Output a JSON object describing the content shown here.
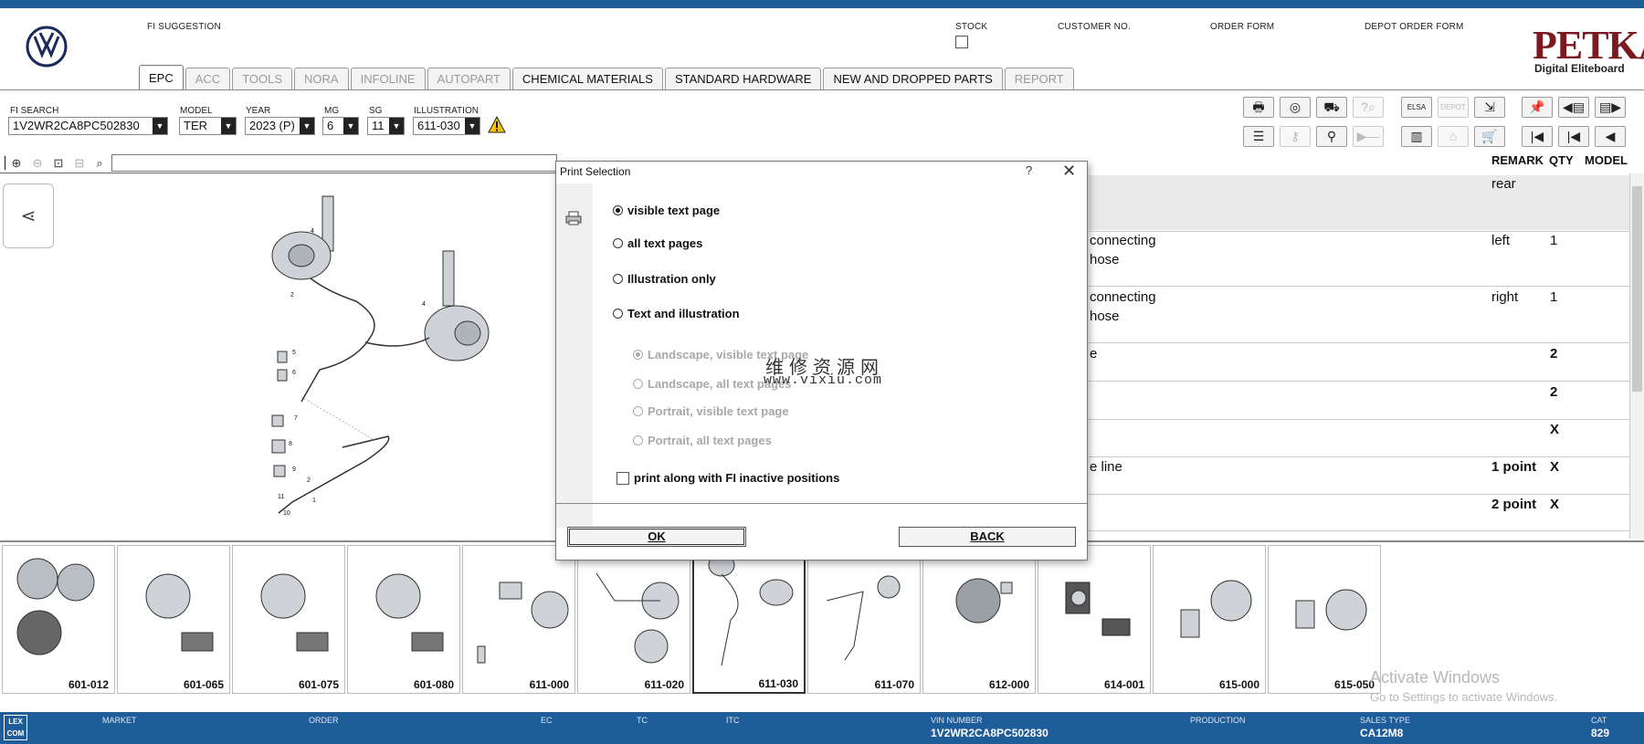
{
  "header": {
    "fi_suggestion_label": "FI SUGGESTION",
    "stock_label": "STOCK",
    "customer_no_label": "CUSTOMER NO.",
    "order_form_label": "ORDER FORM",
    "depot_order_form_label": "DEPOT ORDER FORM",
    "brand": "PETKA",
    "brand_sub": "Digital Eliteboard"
  },
  "tabs": [
    {
      "label": "EPC",
      "state": "active"
    },
    {
      "label": "ACC",
      "state": "disabled"
    },
    {
      "label": "TOOLS",
      "state": "disabled"
    },
    {
      "label": "NORA",
      "state": "disabled"
    },
    {
      "label": "INFOLINE",
      "state": "disabled"
    },
    {
      "label": "AUTOPART",
      "state": "disabled"
    },
    {
      "label": "CHEMICAL MATERIALS",
      "state": "enabled"
    },
    {
      "label": "STANDARD HARDWARE",
      "state": "enabled"
    },
    {
      "label": "NEW AND DROPPED PARTS",
      "state": "enabled"
    },
    {
      "label": "REPORT",
      "state": "disabled"
    }
  ],
  "filters": {
    "fi_search_label": "FI SEARCH",
    "fi_search_value": "1V2WR2CA8PC502830",
    "model_label": "MODEL",
    "model_value": "TER",
    "year_label": "YEAR",
    "year_value": "2023 (P)",
    "mg_label": "MG",
    "mg_value": "6",
    "sg_label": "SG",
    "sg_value": "11",
    "illustration_label": "ILLUSTRATION",
    "illustration_value": "611-030"
  },
  "toolbar_icons": {
    "row1": [
      "print-icon",
      "cd-icon",
      "car-handshake-icon",
      "help-search-icon",
      "elsa-icon",
      "depot-icon",
      "cart-arrow-icon",
      "pin-icon",
      "page-prev-icon",
      "page-next-icon"
    ],
    "row2": [
      "list-icon",
      "key-icon",
      "motorbike-icon",
      "play-icon",
      "device-icon",
      "depot-gray-icon",
      "shopping-cart-icon",
      "first-icon",
      "previous-icon",
      "back-icon"
    ],
    "elsa_label": "ELSA",
    "depot_label": "DEPOT"
  },
  "parts_table": {
    "columns": [
      "REMARK",
      "QTY",
      "MODEL"
    ],
    "rows": [
      {
        "desc": "",
        "desc2": "",
        "remark": "rear",
        "qty": ""
      },
      {
        "desc": "connecting",
        "desc2": "hose",
        "remark": "left",
        "qty": "1"
      },
      {
        "desc": "connecting",
        "desc2": "hose",
        "remark": "right",
        "qty": "1"
      },
      {
        "desc": "e",
        "desc2": "",
        "remark": "",
        "qty": "2"
      },
      {
        "desc": "",
        "desc2": "",
        "remark": "",
        "qty": "2"
      },
      {
        "desc": "",
        "desc2": "",
        "remark": "",
        "qty": "X"
      },
      {
        "desc": "e line",
        "desc2": "",
        "remark": "1 point",
        "qty": "X"
      },
      {
        "desc": "",
        "desc2": "",
        "remark": "2 point",
        "qty": "X"
      }
    ]
  },
  "thumbnails": [
    "601-012",
    "601-065",
    "601-075",
    "601-080",
    "611-000",
    "611-020",
    "611-030",
    "611-070",
    "612-000",
    "614-001",
    "615-000",
    "615-050"
  ],
  "selected_thumbnail": "611-030",
  "dialog": {
    "title": "Print Selection",
    "help": "?",
    "close": "✕",
    "options": [
      {
        "label": "visible text page",
        "checked": true
      },
      {
        "label": "all text pages",
        "checked": false
      },
      {
        "label": "Illustration only",
        "checked": false
      },
      {
        "label": "Text and illustration",
        "checked": false
      }
    ],
    "sub_options": [
      {
        "label": "Landscape, visible text page",
        "checked": true
      },
      {
        "label": "Landscape, all text pages",
        "checked": false
      },
      {
        "label": "Portrait, visible text page",
        "checked": false
      },
      {
        "label": "Portrait, all text pages",
        "checked": false
      }
    ],
    "checkbox_label": "print along with FI inactive positions",
    "ok_label": "OK",
    "back_label": "BACK"
  },
  "watermark": {
    "cn": "维修资源网",
    "url": "www.vixiu.com"
  },
  "windows_activation": {
    "line1": "Activate Windows",
    "line2": "Go to Settings to activate Windows."
  },
  "status_bar": {
    "logo": "LEX COM",
    "market_label": "MARKET",
    "order_label": "ORDER",
    "ec_label": "EC",
    "tc_label": "TC",
    "itc_label": "ITC",
    "vin_label": "VIN NUMBER",
    "vin_value": "1V2WR2CA8PC502830",
    "production_label": "PRODUCTION",
    "sales_type_label": "SALES TYPE",
    "sales_type_value": "CA12M8",
    "cat_label": "CAT",
    "cat_value": "829"
  },
  "colors": {
    "brand_blue": "#1f5d9a",
    "petka_red": "#7a1a20",
    "warning_yellow": "#f5c400"
  }
}
